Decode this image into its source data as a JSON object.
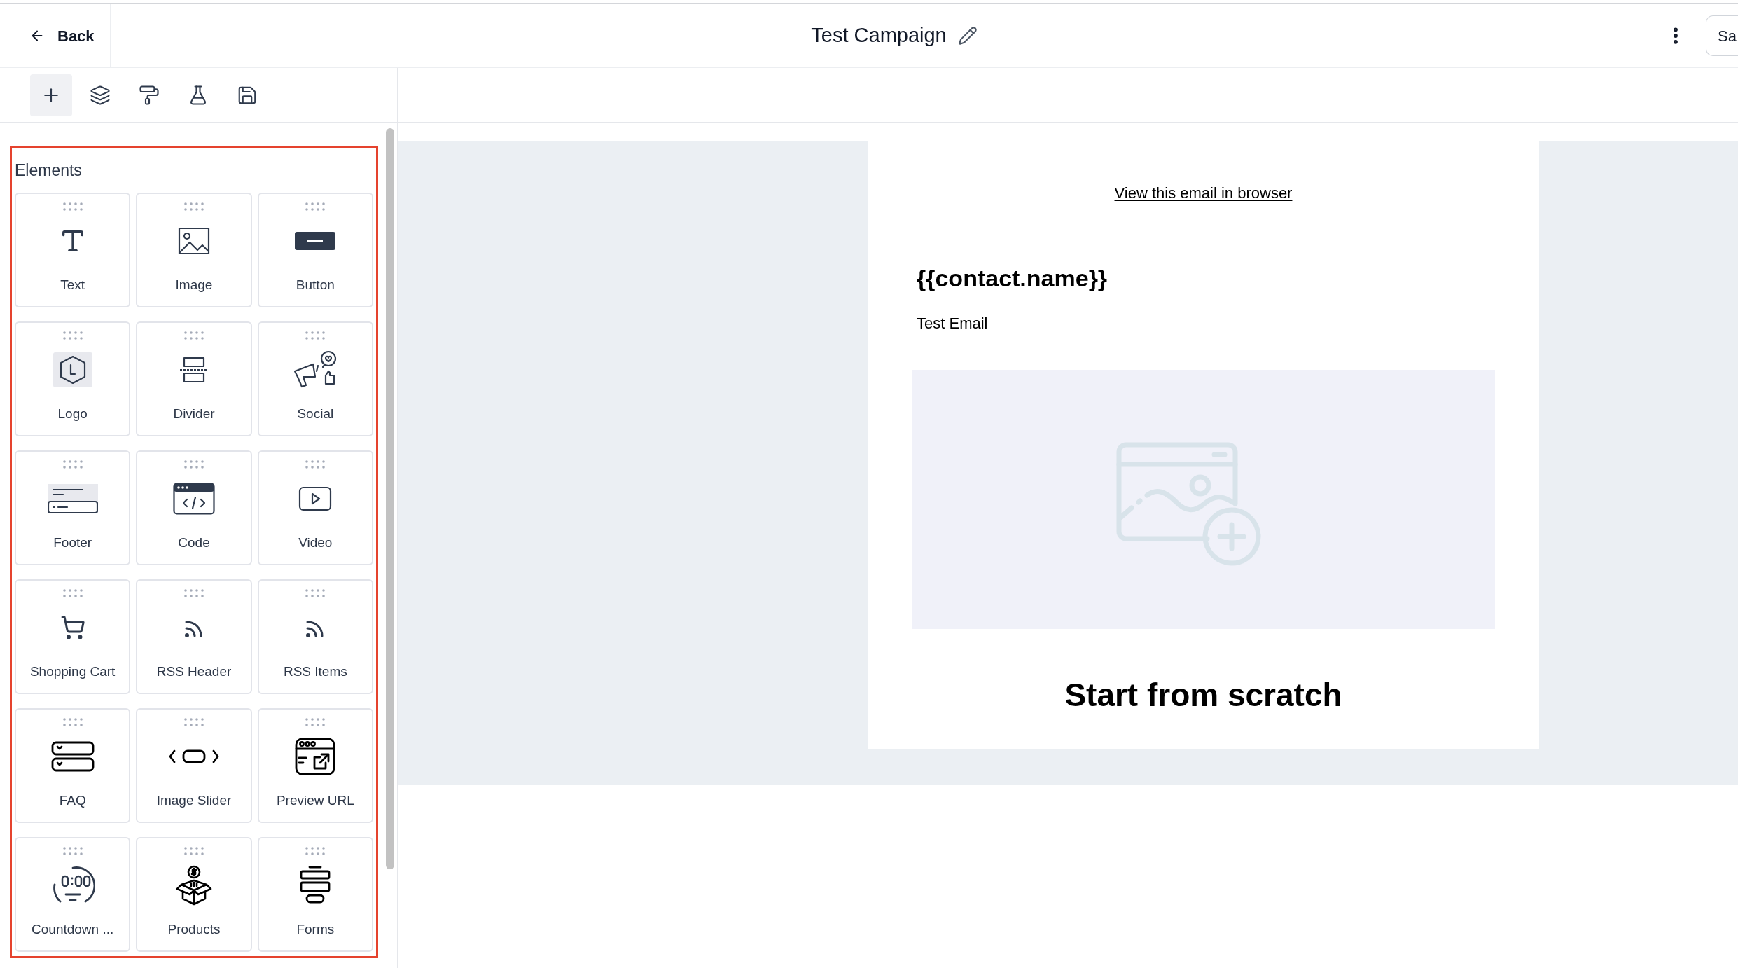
{
  "header": {
    "back": "Back",
    "title": "Test Campaign",
    "save_button": "Sa"
  },
  "toolbar": [
    {
      "selected": true
    },
    {
      "selected": false
    },
    {
      "selected": false
    },
    {
      "selected": false
    },
    {
      "selected": false
    }
  ],
  "panel": {
    "title": "Elements",
    "items": [
      {
        "label": "Text"
      },
      {
        "label": "Image"
      },
      {
        "label": "Button"
      },
      {
        "label": "Logo"
      },
      {
        "label": "Divider"
      },
      {
        "label": "Social"
      },
      {
        "label": "Footer"
      },
      {
        "label": "Code"
      },
      {
        "label": "Video"
      },
      {
        "label": "Shopping Cart"
      },
      {
        "label": "RSS Header"
      },
      {
        "label": "RSS Items"
      },
      {
        "label": "FAQ"
      },
      {
        "label": "Image Slider"
      },
      {
        "label": "Preview URL"
      },
      {
        "label": "Countdown ..."
      },
      {
        "label": "Products"
      },
      {
        "label": "Forms"
      }
    ]
  },
  "email": {
    "browser_link": "View this email in browser",
    "heading": "{{contact.name}}",
    "body": "Test Email",
    "image": {
      "kind": "placeholder"
    },
    "footer_heading": "Start from scratch"
  }
}
